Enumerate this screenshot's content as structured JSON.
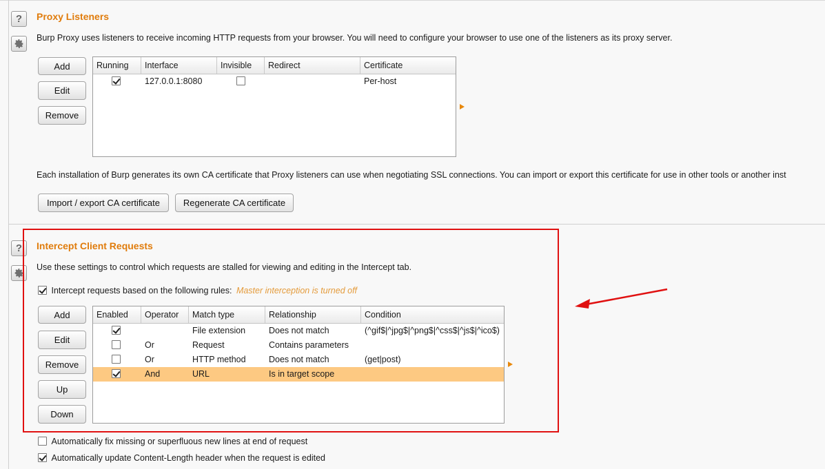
{
  "proxy_listeners": {
    "title": "Proxy Listeners",
    "description": "Burp Proxy uses listeners to receive incoming HTTP requests from your browser. You will need to configure your browser to use one of the listeners as its proxy server.",
    "buttons": {
      "add": "Add",
      "edit": "Edit",
      "remove": "Remove"
    },
    "columns": [
      "Running",
      "Interface",
      "Invisible",
      "Redirect",
      "Certificate"
    ],
    "rows": [
      {
        "running": true,
        "interface": "127.0.0.1:8080",
        "invisible": false,
        "redirect": "",
        "certificate": "Per-host"
      }
    ],
    "ca_description": "Each installation of Burp generates its own CA certificate that Proxy listeners can use when negotiating SSL connections. You can import or export this certificate for use in other tools or another inst",
    "import_export_label": "Import / export CA certificate",
    "regenerate_label": "Regenerate CA certificate"
  },
  "intercept": {
    "title": "Intercept Client Requests",
    "description": "Use these settings to control which requests are stalled for viewing and editing in the Intercept tab.",
    "rules_checkbox_label": "Intercept requests based on the following rules:",
    "rules_checkbox_checked": true,
    "master_note": "Master interception is turned off",
    "buttons": {
      "add": "Add",
      "edit": "Edit",
      "remove": "Remove",
      "up": "Up",
      "down": "Down"
    },
    "columns": [
      "Enabled",
      "Operator",
      "Match type",
      "Relationship",
      "Condition"
    ],
    "rows": [
      {
        "enabled": true,
        "operator": "",
        "match_type": "File extension",
        "relationship": "Does not match",
        "condition": "(^gif$|^jpg$|^png$|^css$|^js$|^ico$)"
      },
      {
        "enabled": false,
        "operator": "Or",
        "match_type": "Request",
        "relationship": "Contains parameters",
        "condition": ""
      },
      {
        "enabled": false,
        "operator": "Or",
        "match_type": "HTTP method",
        "relationship": "Does not match",
        "condition": "(get|post)"
      },
      {
        "enabled": true,
        "operator": "And",
        "match_type": "URL",
        "relationship": "Is in target scope",
        "condition": ""
      }
    ],
    "selected_row": 3,
    "fix_newlines_label": "Automatically fix missing or superfluous new lines at end of request",
    "fix_newlines_checked": false,
    "update_length_label": "Automatically update Content-Length header when the request is edited",
    "update_length_checked": true
  },
  "icons": {
    "help": "help-icon",
    "settings": "gear-icon",
    "expand": "expand-arrow-icon"
  },
  "colors": {
    "title": "#e07c0c",
    "selected_row": "#fdc982",
    "annotation": "#e01010",
    "note": "#e49b3b"
  }
}
